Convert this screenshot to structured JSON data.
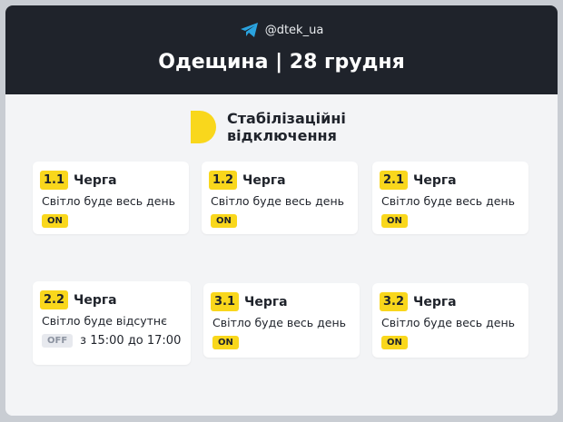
{
  "header": {
    "handle": "@dtek_ua",
    "title": "Одещина | 28 грудня",
    "telegram_icon": "telegram-icon"
  },
  "brand": {
    "line1": "Стабілізаційні",
    "line2": "відключення",
    "logo_icon": "dtek-logo-icon"
  },
  "colors": {
    "accent": "#f9d71c",
    "header_bg": "#1f232b",
    "telegram": "#2aa3df"
  },
  "tiles": [
    {
      "num": "1.1",
      "queue": "Черга",
      "status": "Світло буде весь день",
      "badge": "ON"
    },
    {
      "num": "1.2",
      "queue": "Черга",
      "status": "Світло буде весь день",
      "badge": "ON"
    },
    {
      "num": "2.1",
      "queue": "Черга",
      "status": "Світло буде весь день",
      "badge": "ON"
    },
    {
      "num": "2.2",
      "queue": "Черга",
      "status": "Світло буде відсутнє",
      "badge": "OFF",
      "time": "з 15:00 до 17:00"
    },
    {
      "num": "3.1",
      "queue": "Черга",
      "status": "Світло буде весь день",
      "badge": "ON"
    },
    {
      "num": "3.2",
      "queue": "Черга",
      "status": "Світло буде весь день",
      "badge": "ON"
    }
  ]
}
